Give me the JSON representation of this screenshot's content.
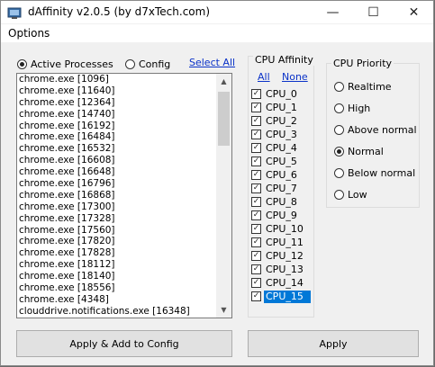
{
  "window": {
    "title": "dAffinity  v2.0.5 (by d7xTech.com)",
    "minimize_glyph": "—",
    "maximize_glyph": "☐",
    "close_glyph": "✕"
  },
  "menu": {
    "options": "Options"
  },
  "source": {
    "active_processes_label": "Active Processes",
    "config_label": "Config",
    "selected": "Active Processes",
    "select_all": "Select All"
  },
  "processes": [
    "chrome.exe  [1096]",
    "chrome.exe  [11640]",
    "chrome.exe  [12364]",
    "chrome.exe  [14740]",
    "chrome.exe  [16192]",
    "chrome.exe  [16484]",
    "chrome.exe  [16532]",
    "chrome.exe  [16608]",
    "chrome.exe  [16648]",
    "chrome.exe  [16796]",
    "chrome.exe  [16868]",
    "chrome.exe  [17300]",
    "chrome.exe  [17328]",
    "chrome.exe  [17560]",
    "chrome.exe  [17820]",
    "chrome.exe  [17828]",
    "chrome.exe  [18112]",
    "chrome.exe  [18140]",
    "chrome.exe  [18556]",
    "chrome.exe  [4348]",
    "clouddrive.notifications.exe  [16348]"
  ],
  "cpu_affinity": {
    "title": "CPU Affinity",
    "all": "All",
    "none": "None",
    "cpus": [
      {
        "label": "CPU_0",
        "checked": true
      },
      {
        "label": "CPU_1",
        "checked": true
      },
      {
        "label": "CPU_2",
        "checked": true
      },
      {
        "label": "CPU_3",
        "checked": true
      },
      {
        "label": "CPU_4",
        "checked": true
      },
      {
        "label": "CPU_5",
        "checked": true
      },
      {
        "label": "CPU_6",
        "checked": true
      },
      {
        "label": "CPU_7",
        "checked": true
      },
      {
        "label": "CPU_8",
        "checked": true
      },
      {
        "label": "CPU_9",
        "checked": true
      },
      {
        "label": "CPU_10",
        "checked": true
      },
      {
        "label": "CPU_11",
        "checked": true
      },
      {
        "label": "CPU_12",
        "checked": true
      },
      {
        "label": "CPU_13",
        "checked": true
      },
      {
        "label": "CPU_14",
        "checked": true
      },
      {
        "label": "CPU_15",
        "checked": true,
        "highlighted": true
      }
    ]
  },
  "cpu_priority": {
    "title": "CPU Priority",
    "options": [
      "Realtime",
      "High",
      "Above normal",
      "Normal",
      "Below normal",
      "Low"
    ],
    "selected": "Normal"
  },
  "buttons": {
    "apply_add_config": "Apply & Add to Config",
    "apply": "Apply"
  },
  "colors": {
    "selection": "#0078d7",
    "link": "#0a32c8"
  }
}
